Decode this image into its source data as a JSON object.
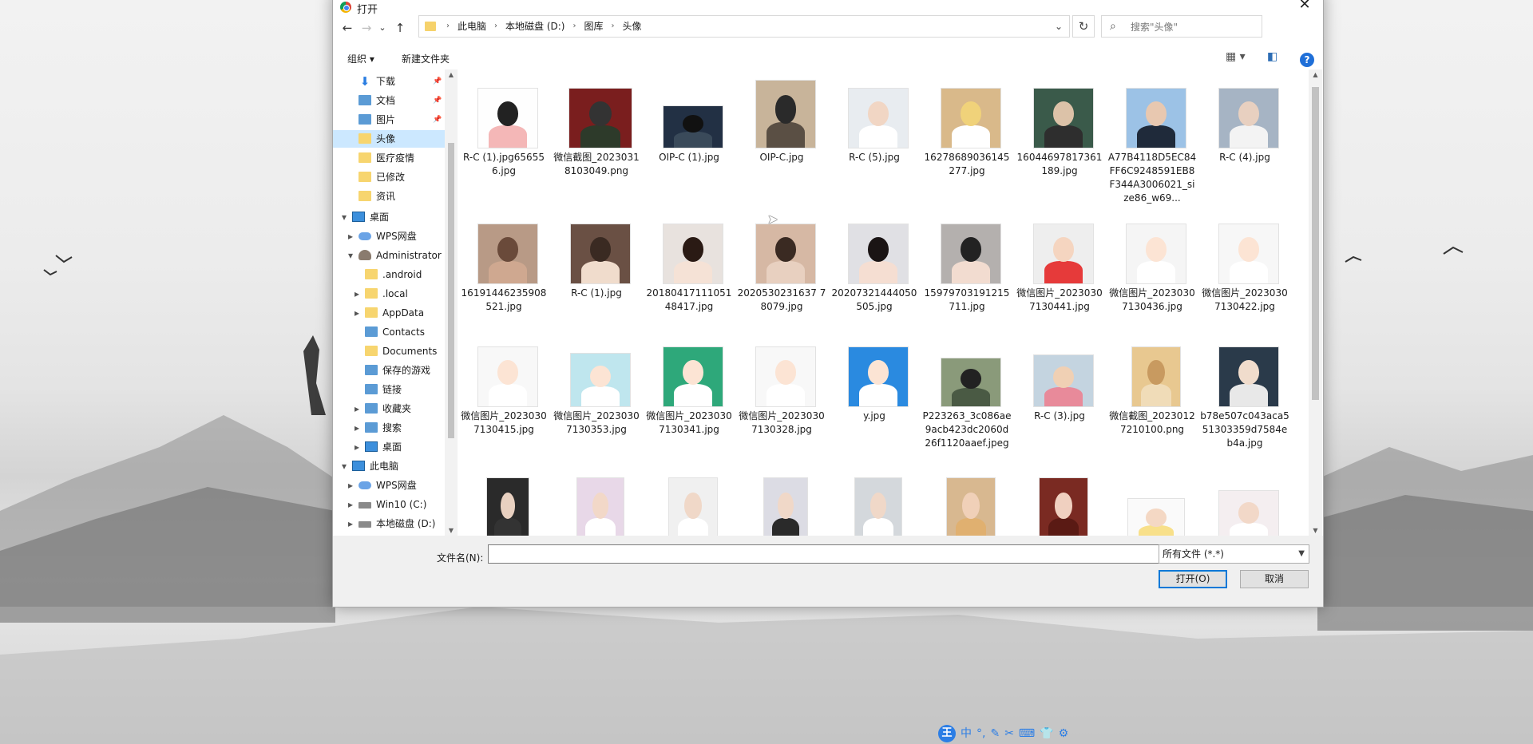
{
  "dialog": {
    "title": "打开",
    "close_glyph": "✕"
  },
  "nav": {
    "back": "←",
    "forward": "→",
    "recent": "⌄",
    "up": "↑",
    "breadcrumbs": [
      "此电脑",
      "本地磁盘 (D:)",
      "图库",
      "头像"
    ],
    "crumb_separator": "›",
    "refresh": "↻",
    "search_placeholder": "搜索\"头像\""
  },
  "toolbar": {
    "organize": "组织 ▾",
    "new_folder": "新建文件夹",
    "view_glyph": "▦ ▾",
    "pane_glyph": "◧",
    "help": "?"
  },
  "tree": [
    {
      "label": "下载",
      "icon": "download-arrow-icon",
      "pinned": true
    },
    {
      "label": "文档",
      "icon": "document-icon",
      "pinned": true
    },
    {
      "label": "图片",
      "icon": "picture-icon",
      "pinned": true
    },
    {
      "label": "头像",
      "icon": "folder-icon",
      "selected": true
    },
    {
      "label": "医疗疫情",
      "icon": "folder-icon"
    },
    {
      "label": "已修改",
      "icon": "folder-icon"
    },
    {
      "label": "资讯",
      "icon": "folder-icon"
    },
    {
      "label": "桌面",
      "icon": "desktop-icon",
      "expanded": true
    },
    {
      "label": "WPS网盘",
      "icon": "cloud-icon"
    },
    {
      "label": "Administrator",
      "icon": "user-icon",
      "expanded": true
    },
    {
      "label": ".android",
      "icon": "folder-icon"
    },
    {
      "label": ".local",
      "icon": "folder-icon"
    },
    {
      "label": "AppData",
      "icon": "folder-icon"
    },
    {
      "label": "Contacts",
      "icon": "contacts-icon"
    },
    {
      "label": "Documents",
      "icon": "folder-icon"
    },
    {
      "label": "保存的游戏",
      "icon": "saved-games-icon"
    },
    {
      "label": "链接",
      "icon": "links-icon"
    },
    {
      "label": "收藏夹",
      "icon": "favorites-icon"
    },
    {
      "label": "搜索",
      "icon": "search-icon"
    },
    {
      "label": "桌面",
      "icon": "desktop-icon"
    },
    {
      "label": "此电脑",
      "icon": "computer-icon",
      "expanded": true
    },
    {
      "label": "WPS网盘",
      "icon": "cloud-icon"
    },
    {
      "label": "Win10 (C:)",
      "icon": "drive-icon"
    },
    {
      "label": "本地磁盘 (D:)",
      "icon": "drive-icon"
    }
  ],
  "files": [
    "R-C (1).jpg656556.jpg",
    "微信截图_20230318103049.png",
    "OIP-C (1).jpg",
    "OIP-C.jpg",
    "R-C (5).jpg",
    "16278689036145277.jpg",
    "16044697817361189.jpg",
    "A77B4118D5EC84FF6C9248591EB8F344A3006021_size86_w69...",
    "R-C (4).jpg",
    "16191446235908521.jpg",
    "R-C (1).jpg",
    "2018041711105148417.jpg",
    "2020530231637 78079.jpg",
    "20207321444050505.jpg",
    "15979703191215711.jpg",
    "微信图片_20230307130441.jpg",
    "微信图片_20230307130436.jpg",
    "微信图片_20230307130422.jpg",
    "微信图片_20230307130415.jpg",
    "微信图片_20230307130353.jpg",
    "微信图片_20230307130341.jpg",
    "微信图片_20230307130328.jpg",
    "y.jpg",
    "P223263_3c086ae9acb423dc2060d26f1120aaef.jpeg",
    "R-C (3).jpg",
    "微信截图_20230127210100.png",
    "b78e507c043aca551303359d7584eb4a.jpg",
    "",
    "",
    "",
    "",
    "",
    "",
    "",
    "",
    ""
  ],
  "bottom": {
    "filename_label": "文件名(N):",
    "filename_value": "",
    "filter": "所有文件 (*.*)",
    "open_button": "打开(O)",
    "cancel_button": "取消"
  },
  "ime": {
    "logo": "王",
    "mode": "中",
    "items": [
      "°,",
      "✎",
      "✂",
      "⌨",
      "👕",
      "⚙"
    ]
  },
  "colors": {
    "selection": "#cce8ff",
    "accent": "#0078d7",
    "folder": "#f7d56f"
  }
}
